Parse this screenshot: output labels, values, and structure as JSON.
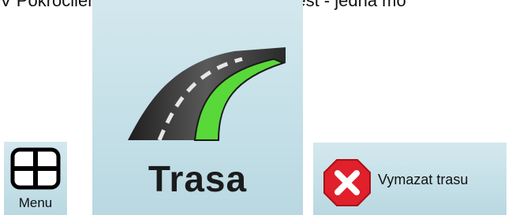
{
  "intro_text": "V Pokročilém režimu máte k dispozici jest - jedna mo",
  "buttons": {
    "menu": {
      "label": "Menu",
      "icon": "window-grid-icon"
    },
    "route": {
      "label": "Trasa",
      "icon": "road-route-icon"
    },
    "delete_route": {
      "label": "Vymazat trasu",
      "icon": "red-x-delete-icon"
    }
  },
  "colors": {
    "tile_background": "#c9e2e9",
    "route_highlight": "#59d83a",
    "road": "#3a3a3a",
    "delete_red": "#e0202a"
  }
}
